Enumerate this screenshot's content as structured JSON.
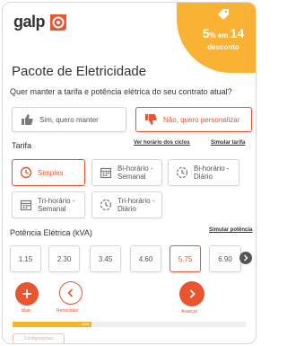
{
  "brand": {
    "name": "galp",
    "accent": "#e8552f",
    "promo_color": "#f9b233"
  },
  "promo": {
    "big": "5",
    "pct": "%",
    "mid": " em ",
    "num": "14",
    "sub": "desconto"
  },
  "page": {
    "title": "Pacote de Eletricidade",
    "question": "Quer manter a tarifa e potência elétrica do seu contrato atual?"
  },
  "choice": {
    "keep_label": "Sim, quero manter",
    "customize_label": "Não, quero personalizar",
    "keep_icon": "thumbs-up-icon",
    "customize_icon": "thumbs-down-icon"
  },
  "tarifa": {
    "label": "Tarifa",
    "link_horarios": "Ver horário dos ciclos",
    "link_simular": "Simular tarifa",
    "options": [
      {
        "label": "Simples",
        "icon": "clock-icon",
        "selected": true
      },
      {
        "label": "Bi-horário - Semanal",
        "icon": "calendar-icon",
        "selected": false
      },
      {
        "label": "Bi-horário - Diário",
        "icon": "clock-slash-icon",
        "selected": false
      },
      {
        "label": "Tri-horário - Semanal",
        "icon": "calendar-icon",
        "selected": false
      },
      {
        "label": "Tri-horário - Diário",
        "icon": "clock-slash-icon",
        "selected": false
      }
    ]
  },
  "potencia": {
    "label": "Potência Elétrica (kVA)",
    "link_simular": "Simular potência",
    "values": [
      "1.15",
      "2.30",
      "3.45",
      "4.60",
      "5.75",
      "6.90"
    ],
    "selected": "5.75"
  },
  "nav": {
    "mais": "Mais",
    "back": "Retroceder",
    "next": "Avançar"
  },
  "progress": {
    "percent": 34,
    "text": "34%"
  },
  "footer": {
    "config_label": "Configurações"
  }
}
